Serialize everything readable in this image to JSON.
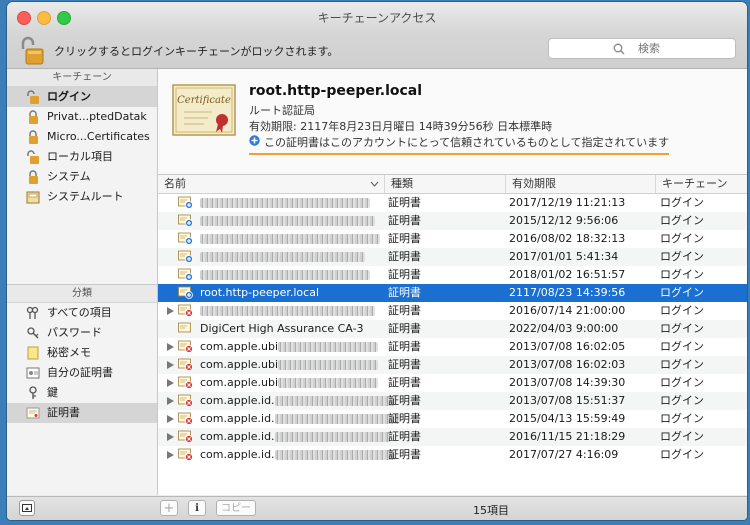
{
  "window": {
    "title": "キーチェーンアクセス"
  },
  "toolbar": {
    "lock_message": "クリックするとログインキーチェーンがロックされます。",
    "search_placeholder": "検索"
  },
  "sidebar": {
    "keychains_header": "キーチェーン",
    "keychains": [
      {
        "label": "ログイン",
        "selected": true
      },
      {
        "label": "Privat...ptedDatak"
      },
      {
        "label": "Micro...Certificates"
      },
      {
        "label": "ローカル項目"
      },
      {
        "label": "システム"
      },
      {
        "label": "システムルート"
      }
    ],
    "categories_header": "分類",
    "categories": [
      {
        "label": "すべての項目"
      },
      {
        "label": "パスワード"
      },
      {
        "label": "秘密メモ"
      },
      {
        "label": "自分の証明書"
      },
      {
        "label": "鍵"
      },
      {
        "label": "証明書",
        "selected": true
      }
    ]
  },
  "detail": {
    "name": "root.http-peeper.local",
    "kind": "ルート認証局",
    "expires": "有効期限: 2117年8月23日月曜日 14時39分56秒 日本標準時",
    "trust": "この証明書はこのアカウントにとって信頼されているものとして指定されています",
    "cert_badge_text": "Certificate"
  },
  "table": {
    "headers": {
      "name": "名前",
      "kind": "種類",
      "expires": "有効期限",
      "keychain": "キーチェーン"
    },
    "rows": [
      {
        "name": "",
        "kind": "証明書",
        "expires": "2017/12/19 11:21:13",
        "keychain": "ログイン"
      },
      {
        "name": "",
        "kind": "証明書",
        "expires": "2015/12/12 9:56:06",
        "keychain": "ログイン"
      },
      {
        "name": "",
        "kind": "証明書",
        "expires": "2016/08/02 18:32:13",
        "keychain": "ログイン"
      },
      {
        "name": "",
        "kind": "証明書",
        "expires": "2017/01/01 5:41:34",
        "keychain": "ログイン"
      },
      {
        "name": "",
        "kind": "証明書",
        "expires": "2018/01/02 16:51:57",
        "keychain": "ログイン"
      },
      {
        "name": "root.http-peeper.local",
        "kind": "証明書",
        "expires": "2117/08/23 14:39:56",
        "keychain": "ログイン",
        "selected": true
      },
      {
        "name": "",
        "kind": "証明書",
        "expires": "2016/07/14 21:00:00",
        "keychain": "ログイン"
      },
      {
        "name": "DigiCert High Assurance CA-3",
        "kind": "証明書",
        "expires": "2022/04/03 9:00:00",
        "keychain": "ログイン"
      },
      {
        "name": "com.apple.ubi",
        "kind": "証明書",
        "expires": "2013/07/08 16:02:05",
        "keychain": "ログイン"
      },
      {
        "name": "com.apple.ubi",
        "kind": "証明書",
        "expires": "2013/07/08 16:02:03",
        "keychain": "ログイン"
      },
      {
        "name": "com.apple.ubi",
        "kind": "証明書",
        "expires": "2013/07/08 14:39:30",
        "keychain": "ログイン"
      },
      {
        "name": "com.apple.id.",
        "kind": "証明書",
        "expires": "2013/07/08 15:51:37",
        "keychain": "ログイン"
      },
      {
        "name": "com.apple.id.",
        "kind": "証明書",
        "expires": "2015/04/13 15:59:49",
        "keychain": "ログイン"
      },
      {
        "name": "com.apple.id.",
        "kind": "証明書",
        "expires": "2016/11/15 21:18:29",
        "keychain": "ログイン"
      },
      {
        "name": "com.apple.id.",
        "kind": "証明書",
        "expires": "2017/07/27 4:16:09",
        "keychain": "ログイン"
      }
    ]
  },
  "statusbar": {
    "add_label": "+",
    "info_label": "i",
    "copy_label": "コピー",
    "count": "15項目"
  },
  "colors": {
    "selection": "#1a6fd0",
    "trust_underline": "#f0a030"
  }
}
